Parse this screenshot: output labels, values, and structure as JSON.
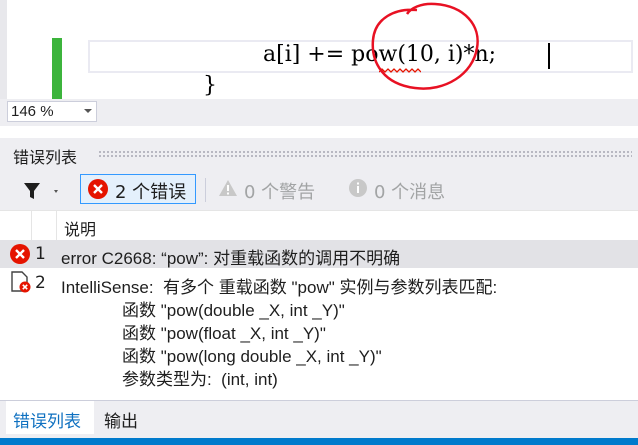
{
  "editor": {
    "code_line1": "a[i] += pow(10, i)*n;",
    "code_line2": "}"
  },
  "zoom": {
    "value": "146 %"
  },
  "error_list": {
    "title": "错误列表",
    "filters": {
      "errors_label": "2 个错误",
      "warnings_label": "0 个警告",
      "messages_label": "0 个消息"
    },
    "columns": {
      "description": "说明"
    },
    "rows": [
      {
        "number": "1",
        "icon": "error-icon",
        "lines": [
          "error C2668: “pow”: 对重载函数的调用不明确"
        ]
      },
      {
        "number": "2",
        "icon": "intellisense-error-icon",
        "lines": [
          "IntelliSense:  有多个 重载函数 \"pow\" 实例与参数列表匹配:",
          "函数 \"pow(double _X, int _Y)\"",
          "函数 \"pow(float _X, int _Y)\"",
          "函数 \"pow(long double _X, int _Y)\"",
          "参数类型为:  (int, int)"
        ]
      }
    ]
  },
  "tabs": {
    "errors": "错误列表",
    "output": "输出"
  },
  "colors": {
    "accent": "#007acc",
    "error_red": "#e51400",
    "annotation_red": "#e81123",
    "gutter_green": "#3cb43c",
    "active_tab_text": "#0e70c0"
  }
}
